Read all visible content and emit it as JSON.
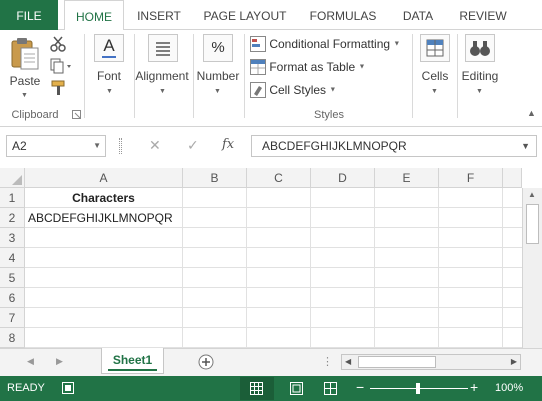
{
  "tabs": [
    {
      "label": "FILE"
    },
    {
      "label": "HOME"
    },
    {
      "label": "INSERT"
    },
    {
      "label": "PAGE LAYOUT"
    },
    {
      "label": "FORMULAS"
    },
    {
      "label": "DATA"
    },
    {
      "label": "REVIEW"
    }
  ],
  "ribbon": {
    "paste_label": "Paste",
    "clipboard_label": "Clipboard",
    "font_label": "Font",
    "alignment_label": "Alignment",
    "number_label": "Number",
    "number_icon_text": "%",
    "font_icon_text": "A",
    "conditional_formatting": "Conditional Formatting",
    "format_as_table": "Format as Table",
    "cell_styles": "Cell Styles",
    "styles_label": "Styles",
    "cells_label": "Cells",
    "editing_label": "Editing"
  },
  "formula_bar": {
    "name_box": "A2",
    "fx": "fx",
    "content": "ABCDEFGHIJKLMNOPQR"
  },
  "columns": [
    "A",
    "B",
    "C",
    "D",
    "E",
    "F"
  ],
  "rows": [
    "1",
    "2",
    "3",
    "4",
    "5",
    "6",
    "7",
    "8"
  ],
  "cells": {
    "A1": "Characters",
    "A2": "ABCDEFGHIJKLMNOPQR"
  },
  "sheet_tab": "Sheet1",
  "status": {
    "ready": "READY",
    "zoom": "100%",
    "minus": "−",
    "plus": "+"
  },
  "colors": {
    "accent": "#217346"
  }
}
